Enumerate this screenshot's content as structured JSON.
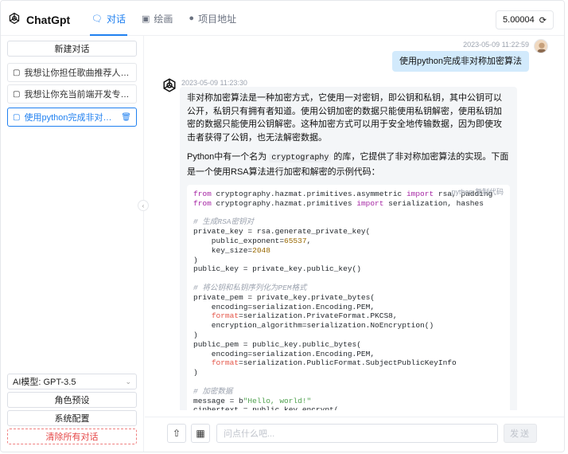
{
  "header": {
    "brand": "ChatGpt",
    "tabs": [
      {
        "label": "对话",
        "icon": "chat-icon",
        "active": true
      },
      {
        "label": "绘画",
        "icon": "image-icon",
        "active": false
      },
      {
        "label": "项目地址",
        "icon": "github-icon",
        "active": false
      }
    ],
    "balance": "5.00004"
  },
  "sidebar": {
    "new_chat": "新建对话",
    "conversations": [
      {
        "title": "我想让你担任歌曲推荐人。我将为你提供",
        "active": false
      },
      {
        "title": "我想让你充当前端开发专家。我将提供一",
        "active": false
      },
      {
        "title": "使用python完成非对称加密算法",
        "active": true
      }
    ],
    "model_select": "AI模型: GPT-3.5",
    "role_preset": "角色预设",
    "system_config": "系统配置",
    "clear_all": "清除所有对话"
  },
  "chat": {
    "user_message": {
      "time": "2023-05-09 11:22:59",
      "text": "使用python完成非对称加密算法"
    },
    "bot_message": {
      "time": "2023-05-09 11:23:30",
      "para1": "非对称加密算法是一种加密方式，它使用一对密钥，即公钥和私钥，其中公钥可以公开，私钥只有拥有者知道。使用公钥加密的数据只能使用私钥解密，使用私钥加密的数据只能使用公钥解密。这种加密方式可以用于安全地传输数据，因为即使攻击者获得了公钥，也无法解密数据。",
      "para2_a": "Python中有一个名为",
      "para2_code": "cryptography",
      "para2_b": "的库，它提供了非对称加密算法的实现。下面是一个使用RSA算法进行加密和解密的示例代码：",
      "code_lang": "python",
      "code_copy": "复制代码"
    }
  },
  "footer": {
    "placeholder": "问点什么吧...",
    "send": "发送"
  }
}
